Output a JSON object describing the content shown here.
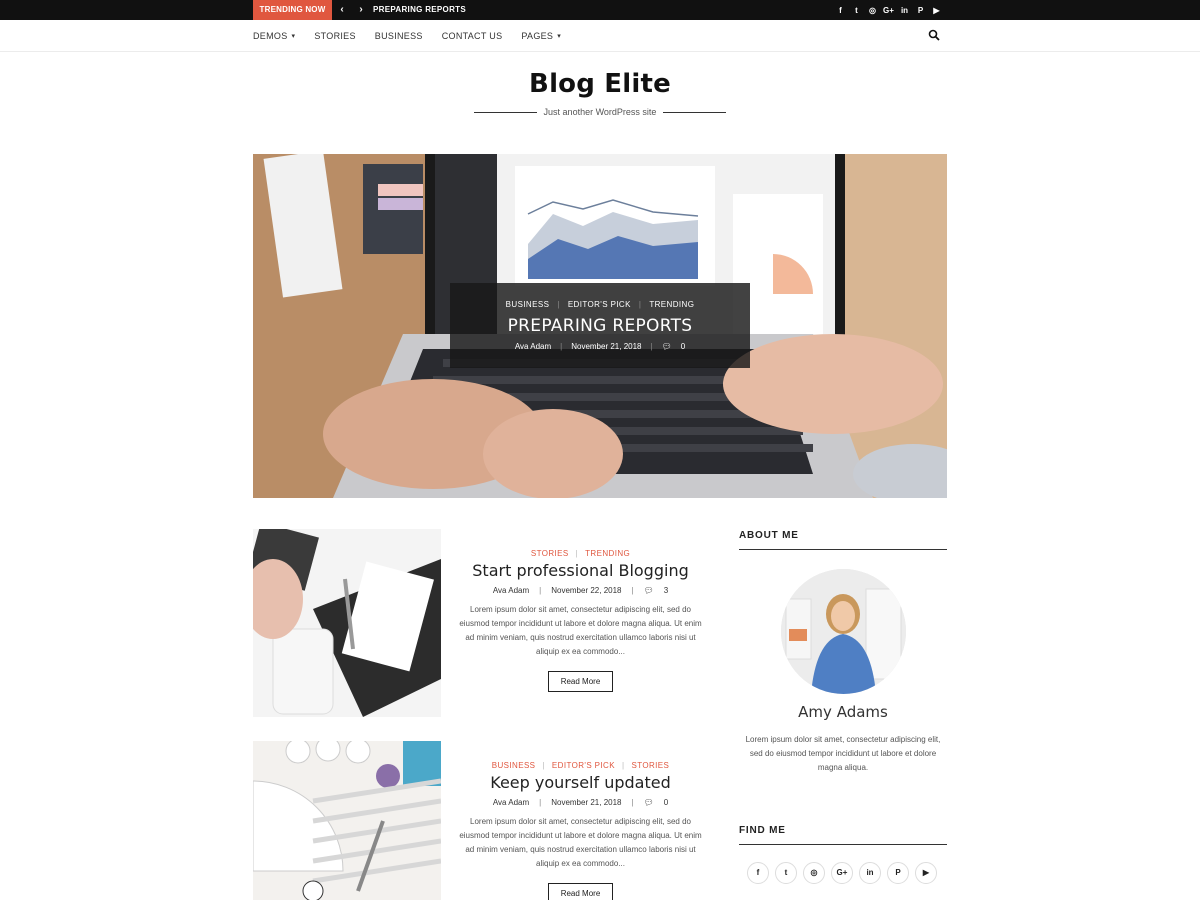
{
  "topbar": {
    "trending_label": "TRENDING NOW",
    "prev_icon": "chevron-left-icon",
    "next_icon": "chevron-right-icon",
    "ticker_title": "PREPARING REPORTS",
    "social": [
      {
        "name": "facebook",
        "glyph": "f"
      },
      {
        "name": "twitter",
        "glyph": "t"
      },
      {
        "name": "instagram",
        "glyph": "◎"
      },
      {
        "name": "google-plus",
        "glyph": "G+"
      },
      {
        "name": "linkedin",
        "glyph": "in"
      },
      {
        "name": "pinterest",
        "glyph": "P"
      },
      {
        "name": "youtube",
        "glyph": "▶"
      }
    ]
  },
  "nav": {
    "items": [
      {
        "label": "DEMOS",
        "has_dropdown": true
      },
      {
        "label": "STORIES",
        "has_dropdown": false
      },
      {
        "label": "BUSINESS",
        "has_dropdown": false
      },
      {
        "label": "CONTACT US",
        "has_dropdown": false
      },
      {
        "label": "PAGES",
        "has_dropdown": true
      }
    ],
    "search_icon": "search-icon"
  },
  "site": {
    "title": "Blog Elite",
    "tagline": "Just another WordPress site"
  },
  "hero": {
    "categories": [
      "BUSINESS",
      "EDITOR'S PICK",
      "TRENDING"
    ],
    "title": "PREPARING REPORTS",
    "author": "Ava Adam",
    "date": "November 21, 2018",
    "comments": "0"
  },
  "posts": [
    {
      "categories": [
        "STORIES",
        "TRENDING"
      ],
      "title": "Start professional Blogging",
      "author": "Ava Adam",
      "date": "November 22, 2018",
      "comments": "3",
      "excerpt": "Lorem ipsum dolor sit amet, consectetur adipiscing elit, sed do eiusmod tempor incididunt ut labore et dolore magna aliqua. Ut enim ad minim veniam, quis nostrud exercitation ullamco laboris nisi ut aliquip ex ea commodo...",
      "read_more": "Read More"
    },
    {
      "categories": [
        "BUSINESS",
        "EDITOR'S PICK",
        "STORIES"
      ],
      "title": "Keep yourself updated",
      "author": "Ava Adam",
      "date": "November 21, 2018",
      "comments": "0",
      "excerpt": "Lorem ipsum dolor sit amet, consectetur adipiscing elit, sed do eiusmod tempor incididunt ut labore et dolore magna aliqua. Ut enim ad minim veniam, quis nostrud exercitation ullamco laboris nisi ut aliquip ex ea commodo...",
      "read_more": "Read More"
    }
  ],
  "sidebar": {
    "about_title": "ABOUT ME",
    "about_name": "Amy Adams",
    "about_text": "Lorem ipsum dolor sit amet, consectetur adipiscing elit, sed do eiusmod tempor incididunt ut labore et dolore magna aliqua.",
    "find_title": "FIND ME",
    "social": [
      {
        "name": "facebook",
        "glyph": "f"
      },
      {
        "name": "twitter",
        "glyph": "t"
      },
      {
        "name": "instagram",
        "glyph": "◎"
      },
      {
        "name": "google-plus",
        "glyph": "G+"
      },
      {
        "name": "linkedin",
        "glyph": "in"
      },
      {
        "name": "pinterest",
        "glyph": "P"
      },
      {
        "name": "youtube",
        "glyph": "▶"
      }
    ]
  },
  "colors": {
    "accent": "#e0573f",
    "topbar_bg": "#111111",
    "text": "#222222"
  }
}
